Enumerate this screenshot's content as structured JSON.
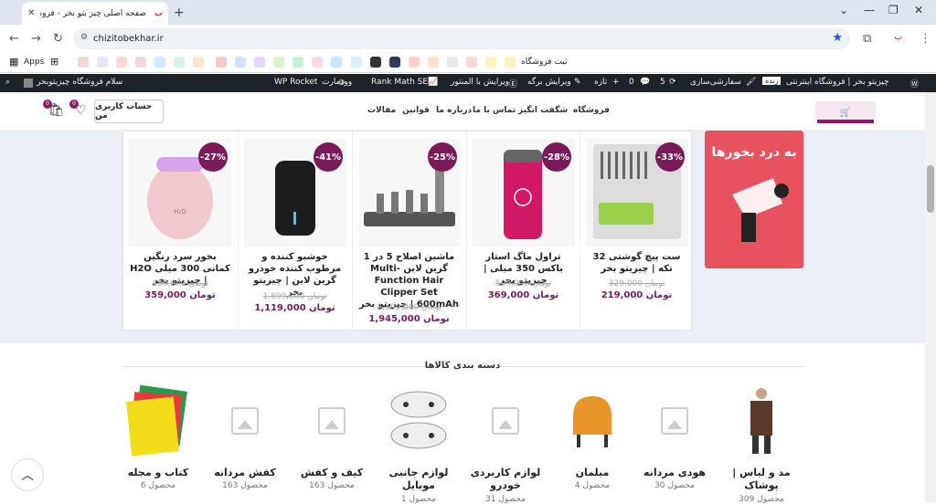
{
  "browser": {
    "tab_title": "صفحه اصلی چیز بتو بخر - فروشگاه",
    "url": "chizitobekhar.ir",
    "bookmarks_apps": "Apps",
    "bookmark_shop": "ثبت فروشگاه"
  },
  "wpbar": {
    "site": "چیزیتو بخر | فروشگاه اینترنتی",
    "live": "زنده",
    "customize": "سفارشی‌سازی",
    "updates": "5",
    "comments": "0",
    "new": "تازه",
    "edit_page": "ویرایش برگه",
    "elementor": "ویرایش با المنتور",
    "rankmath": "Rank Math SEO",
    "wordfence": "وودمارت",
    "wprocket": "WP Rocket",
    "greeting": "سلام فروشگاه چیزیتوبخر"
  },
  "header": {
    "menu": [
      "فروشگاه",
      "شگفت انگیز",
      "تماس با ما",
      "درباره ما",
      "قوانین",
      "مقالات"
    ],
    "account": "حساب کاربری من",
    "wishlist_count": "0",
    "cart_count": "0"
  },
  "promo": {
    "title": "به درد بخورها"
  },
  "products": [
    {
      "discount": "-33%",
      "name": "ست پیچ گوشتی 32 تکه | چیزیتو بخر",
      "old": "329,000 تومان",
      "new": "219,000 تومان"
    },
    {
      "discount": "-28%",
      "name": "تراول ماگ استار باکس 350 میلی | چیزیتو بخر",
      "old": "509,000 تومان",
      "new": "369,000 تومان"
    },
    {
      "discount": "-25%",
      "name": "ماشین اصلاح 5 در 1 گرین لاین Multi-Function Hair Clipper Set 600mAh | چیزیتو بخر",
      "old": "2,599,000 تومان",
      "new": "1,945,000 تومان"
    },
    {
      "discount": "-41%",
      "name": "خوشبو کننده و مرطوب کننده خودرو گرین لاین | چیزیتو بخر",
      "old": "1,899,000 تومان",
      "new": "1,119,000 تومان"
    },
    {
      "discount": "-27%",
      "name": "بخور سرد رنگین کمانی 300 میلی H2O | چیزیتو بخر",
      "old": "489,000 تومان",
      "new": "359,000 تومان"
    }
  ],
  "categories_title": "دسته بندی کالاها",
  "categories": [
    {
      "name": "مد و لباس | پوشاک",
      "count": "309 محصول"
    },
    {
      "name": "هودی مردانه",
      "count": "30 محصول"
    },
    {
      "name": "مبلمان",
      "count": "4 محصول"
    },
    {
      "name": "لوازم کاربردی خودرو",
      "count": "31 محصول"
    },
    {
      "name": "لوازم جانبی موبایل",
      "count": "1 محصول"
    },
    {
      "name": "کیف و کفش",
      "count": "163 محصول"
    },
    {
      "name": "کفش مردانه",
      "count": "163 محصول"
    },
    {
      "name": "کتاب و مجله",
      "count": "6 محصول"
    }
  ],
  "colors": {
    "accent": "#7a1a5a",
    "wp_bar": "#1d2327",
    "section_bg": "#e9eef7",
    "promo": "#e8525f"
  }
}
